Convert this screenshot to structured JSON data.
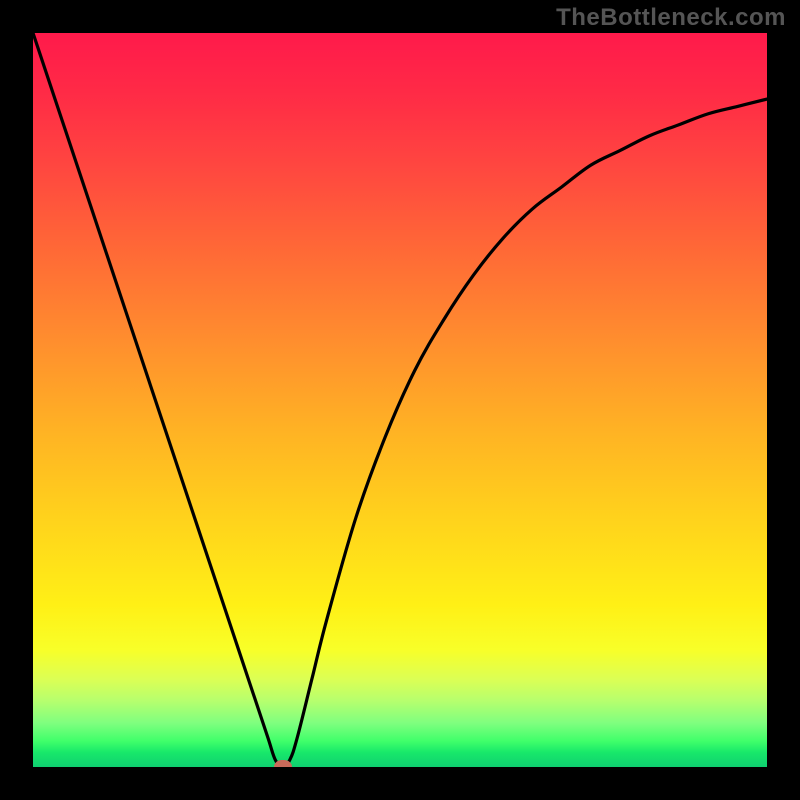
{
  "watermark": "TheBottleneck.com",
  "colors": {
    "background": "#000000",
    "curve": "#000000",
    "marker": "#c96a5a"
  },
  "chart_data": {
    "type": "line",
    "title": "",
    "xlabel": "",
    "ylabel": "",
    "xlim": [
      0,
      100
    ],
    "ylim": [
      0,
      100
    ],
    "grid": false,
    "series": [
      {
        "name": "bottleneck-curve",
        "x": [
          0,
          4,
          8,
          12,
          16,
          20,
          24,
          28,
          30,
          32,
          33,
          34,
          35,
          36,
          38,
          40,
          44,
          48,
          52,
          56,
          60,
          64,
          68,
          72,
          76,
          80,
          84,
          88,
          92,
          96,
          100
        ],
        "values": [
          100,
          88,
          76,
          64,
          52,
          40,
          28,
          16,
          10,
          4,
          1,
          0,
          1,
          4,
          12,
          20,
          34,
          45,
          54,
          61,
          67,
          72,
          76,
          79,
          82,
          84,
          86,
          87.5,
          89,
          90,
          91
        ]
      }
    ],
    "marker": {
      "x": 34,
      "y": 0
    },
    "description": "V-shaped bottleneck curve over vertical rainbow heat gradient (red top to green bottom). Minimum at roughly x=34% where curve touches baseline; left branch is straight, right branch rises and flattens toward ~91%."
  }
}
